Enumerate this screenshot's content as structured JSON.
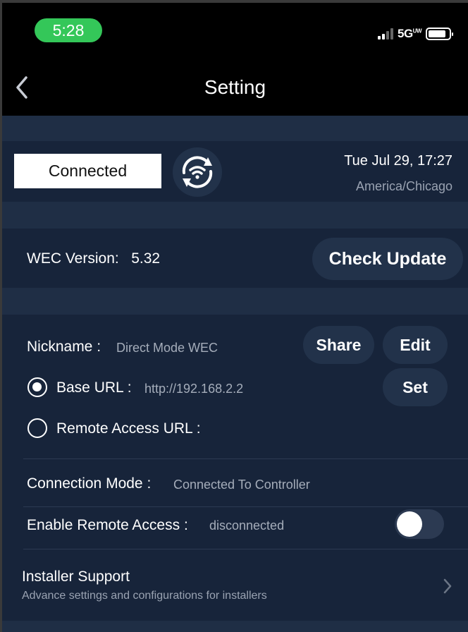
{
  "status_bar": {
    "time": "5:28",
    "network": "5G",
    "network_sup": "UW",
    "signal_bars": 2,
    "time_pill_color": "#34c759"
  },
  "header": {
    "title": "Setting",
    "back_icon": "chevron-left-icon"
  },
  "connection": {
    "status": "Connected",
    "sync_icon": "wifi-sync-icon",
    "date_time": "Tue Jul 29, 17:27",
    "timezone": "America/Chicago"
  },
  "version": {
    "label": "WEC Version:",
    "value": "5.32",
    "check_update": "Check Update"
  },
  "device": {
    "nickname_label": "Nickname :",
    "nickname_value": "Direct Mode WEC",
    "share": "Share",
    "edit": "Edit",
    "base_url_label": "Base URL :",
    "base_url_value": "http://192.168.2.2",
    "base_url_selected": true,
    "set": "Set",
    "remote_url_label": "Remote Access URL :",
    "remote_url_selected": false
  },
  "connection_mode": {
    "label": "Connection Mode :",
    "value": "Connected To Controller"
  },
  "remote_access": {
    "label": "Enable Remote Access :",
    "value": "disconnected",
    "enabled": false
  },
  "installer": {
    "title": "Installer Support",
    "subtitle": "Advance settings and configurations for installers",
    "chevron_icon": "chevron-right-icon"
  },
  "colors": {
    "background": "#17243a",
    "band": "#1f2e45",
    "button": "#22324a"
  }
}
